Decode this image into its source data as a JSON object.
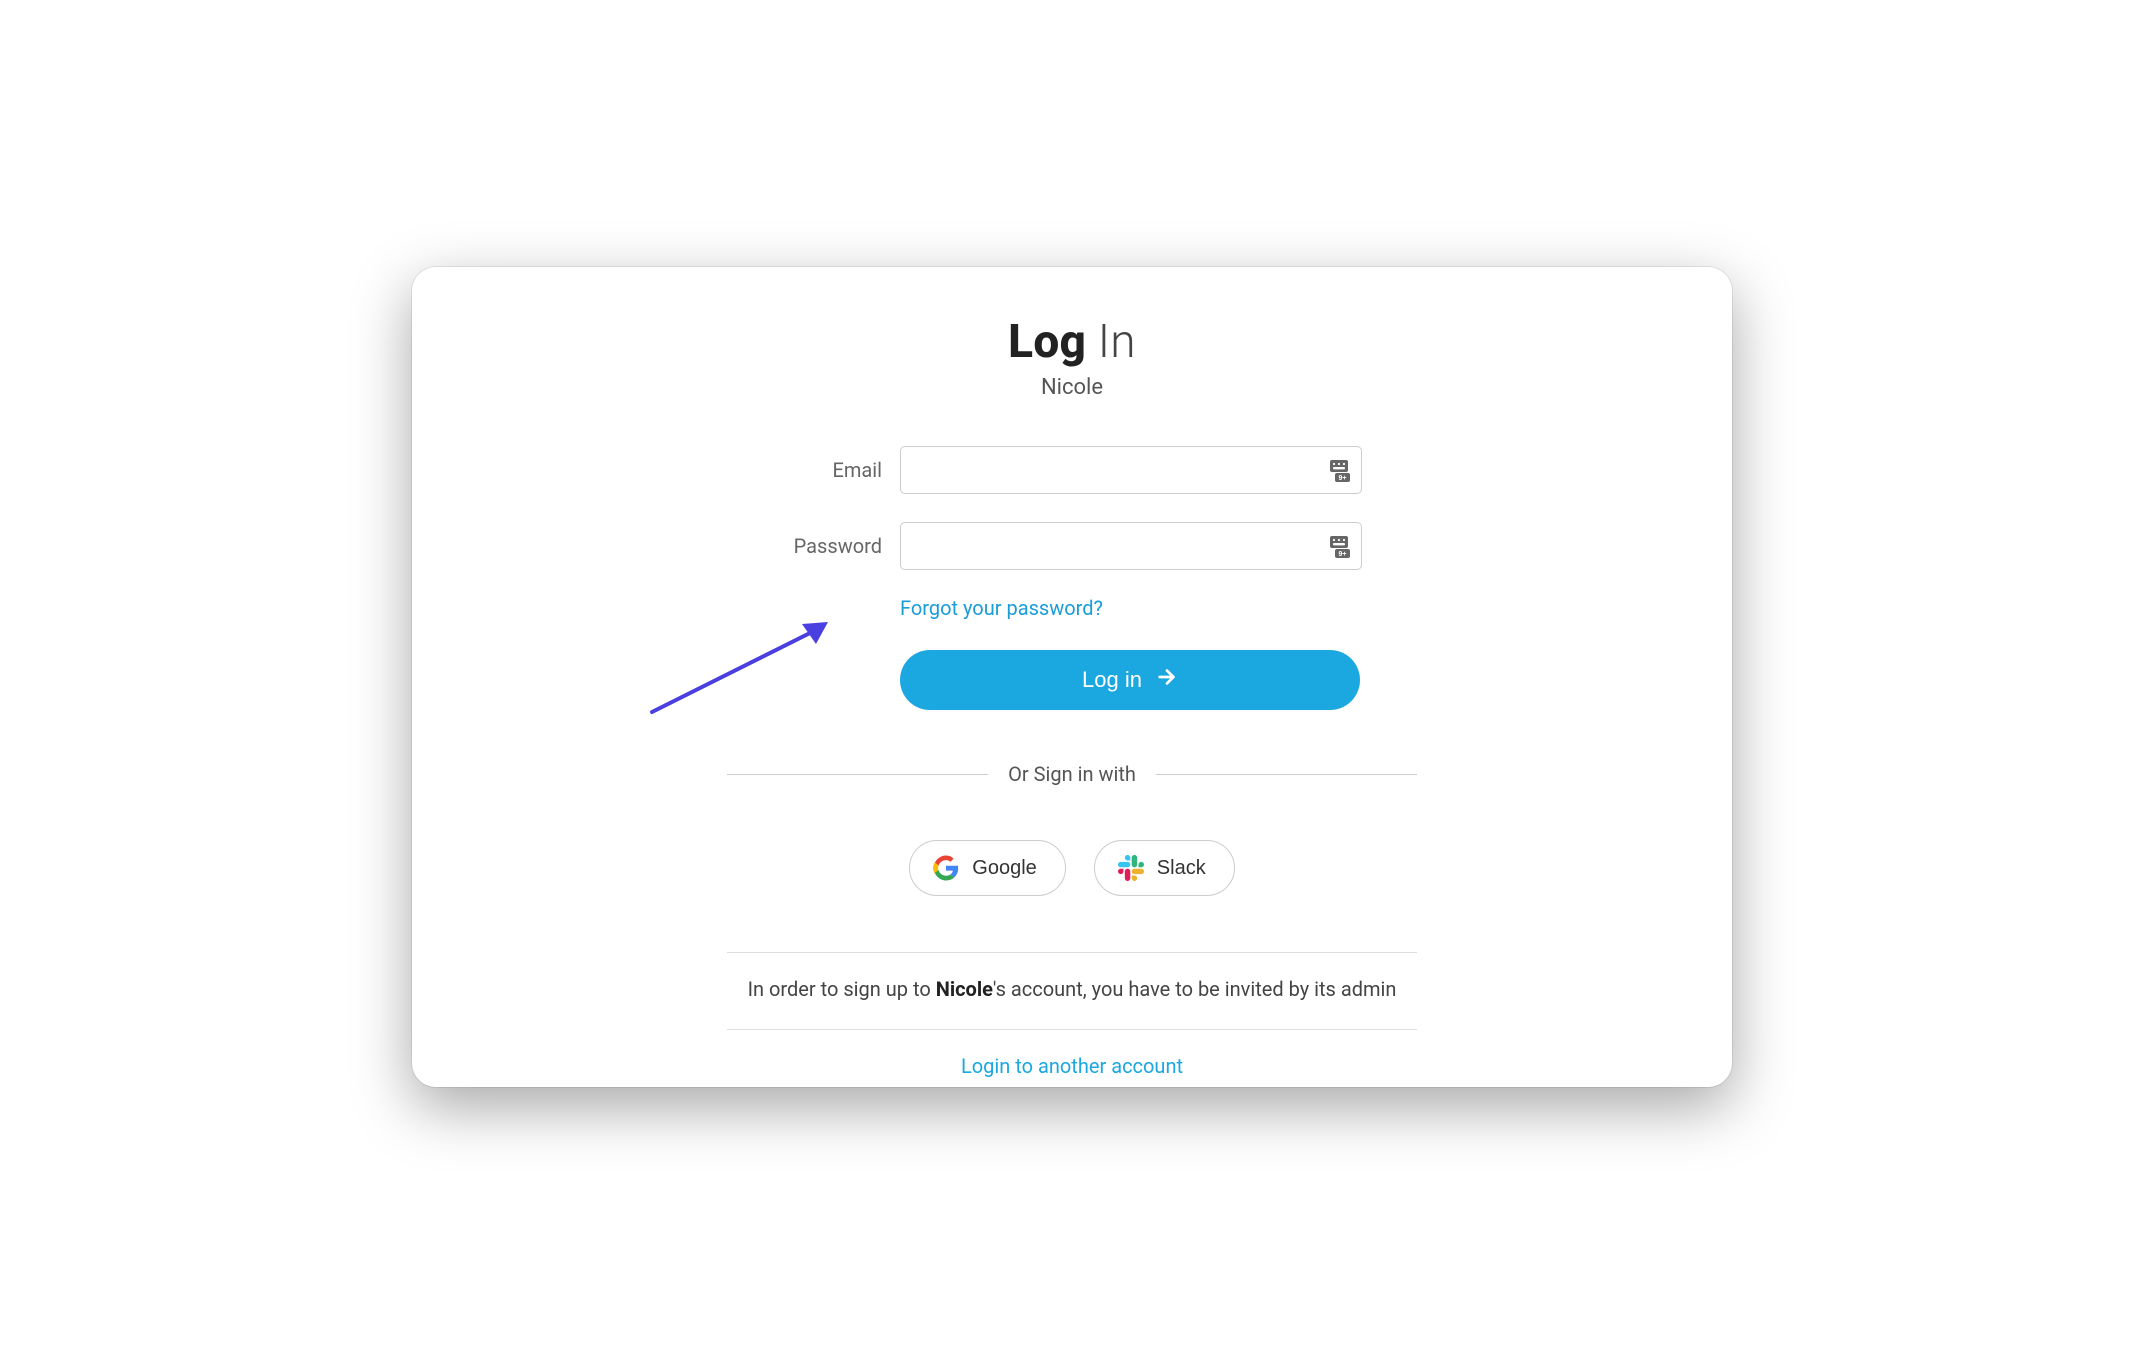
{
  "title": {
    "bold": "Log",
    "light": " In"
  },
  "subtitle": "Nicole",
  "form": {
    "email_label": "Email",
    "password_label": "Password",
    "email_value": "",
    "password_value": ""
  },
  "forgot_text": "Forgot your password?",
  "login_button": "Log in",
  "divider_text": "Or Sign in with",
  "sso": {
    "google": "Google",
    "slack": "Slack"
  },
  "invite": {
    "prefix": "In order to sign up to ",
    "name": "Nicole",
    "suffix": "'s account, you have to be invited by its admin"
  },
  "another_account": "Login to another account"
}
